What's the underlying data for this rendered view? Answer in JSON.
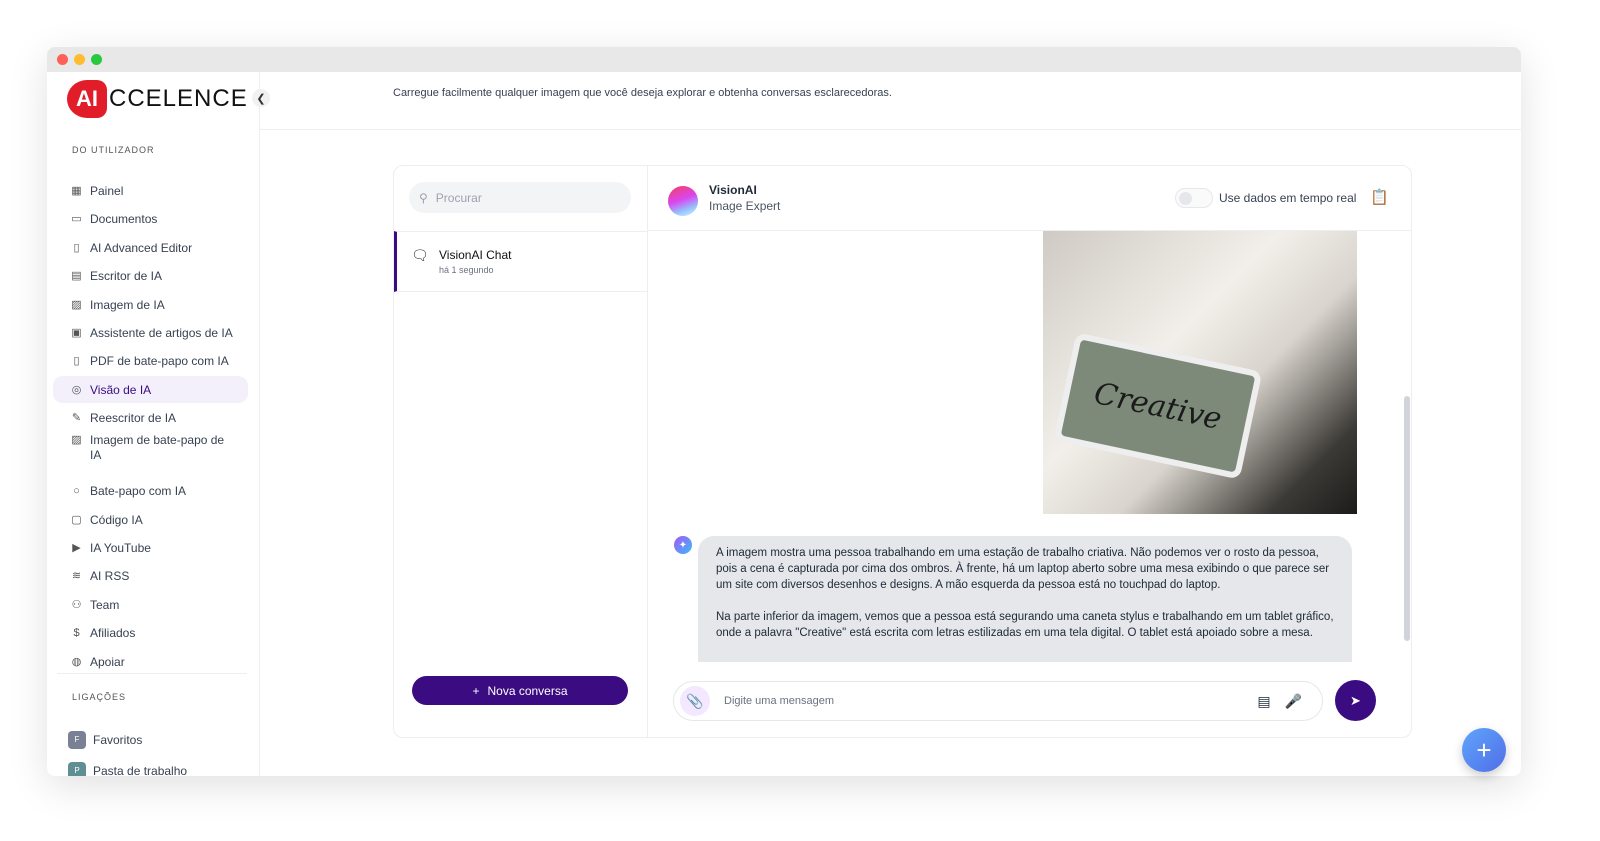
{
  "brand": {
    "logo_mark": "AI",
    "logo_text": "CCELENCE"
  },
  "header": {
    "subtitle": "Carregue facilmente qualquer imagem que você deseja explorar e obtenha conversas esclarecedoras."
  },
  "sidebar": {
    "section_user": "DO UTILIZADOR",
    "items": [
      {
        "label": "Painel",
        "icon": "grid-icon"
      },
      {
        "label": "Documentos",
        "icon": "archive-icon"
      },
      {
        "label": "AI Advanced Editor",
        "icon": "editor-icon"
      },
      {
        "label": "Escritor de IA",
        "icon": "document-icon"
      },
      {
        "label": "Imagem de IA",
        "icon": "image-icon"
      },
      {
        "label": "Assistente de artigos de IA",
        "icon": "article-icon"
      },
      {
        "label": "PDF de bate-papo com IA",
        "icon": "pdf-icon"
      },
      {
        "label": "Visão de IA",
        "icon": "eye-scan-icon",
        "active": true
      },
      {
        "label": "Reescritor de IA",
        "icon": "pen-icon"
      },
      {
        "label": "Imagem de bate-papo de IA",
        "icon": "image-chat-icon"
      },
      {
        "label": "Bate-papo com IA",
        "icon": "chat-icon"
      },
      {
        "label": "Código IA",
        "icon": "terminal-icon"
      },
      {
        "label": "IA YouTube",
        "icon": "youtube-icon"
      },
      {
        "label": "AI RSS",
        "icon": "rss-icon"
      },
      {
        "label": "Team",
        "icon": "user-plus-icon"
      },
      {
        "label": "Afiliados",
        "icon": "dollar-icon"
      },
      {
        "label": "Apoiar",
        "icon": "lifebuoy-icon"
      }
    ],
    "section_links": "LIGAÇÕES",
    "links": [
      {
        "letter": "F",
        "label": "Favoritos",
        "color": "#7b8194"
      },
      {
        "letter": "P",
        "label": "Pasta de trabalho",
        "color": "#5f8f92"
      }
    ]
  },
  "chat_list": {
    "search_placeholder": "Procurar",
    "conversations": [
      {
        "title": "VisionAI Chat",
        "time": "há 1 segundo"
      }
    ],
    "new_button": "Nova conversa"
  },
  "chat": {
    "bot_name": "VisionAI",
    "bot_role": "Image Expert",
    "realtime_label": "Use dados em tempo real",
    "realtime_on": false,
    "image_text": "Creative",
    "messages": [
      "A imagem mostra uma pessoa trabalhando em uma estação de trabalho criativa. Não podemos ver o rosto da pessoa, pois a cena é capturada por cima dos ombros. À frente, há um laptop aberto sobre uma mesa exibindo o que parece ser um site com diversos desenhos e designs. A mão esquerda da pessoa está no touchpad do laptop.",
      "Na parte inferior da imagem, vemos que a pessoa está segurando uma caneta stylus e trabalhando em um tablet gráfico, onde a palavra \"Creative\" está escrita com letras estilizadas em uma tela digital. O tablet está apoiado sobre a mesa."
    ],
    "input_placeholder": "Digite uma mensagem"
  },
  "colors": {
    "accent": "#3b0b82",
    "active_bg": "#f3f0fb",
    "logo_red": "#e11d2a"
  }
}
